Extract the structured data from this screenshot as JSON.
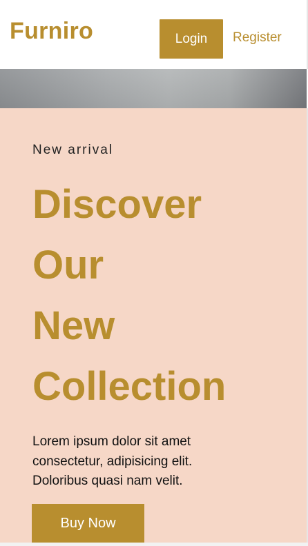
{
  "header": {
    "logo": "Furniro",
    "login_label": "Login",
    "register_label": "Register"
  },
  "hero": {
    "eyebrow": "New arrival",
    "headline_lines": [
      "Discover",
      "Our",
      "New",
      "Collection"
    ],
    "description_lines": [
      "Lorem ipsum dolor sit amet",
      "consectetur, adipisicing elit.",
      "Doloribus quasi nam velit."
    ],
    "cta_label": "Buy Now"
  },
  "colors": {
    "accent": "#b88e2f",
    "hero_background": "#f6d7c7",
    "text_dark": "#111111"
  }
}
